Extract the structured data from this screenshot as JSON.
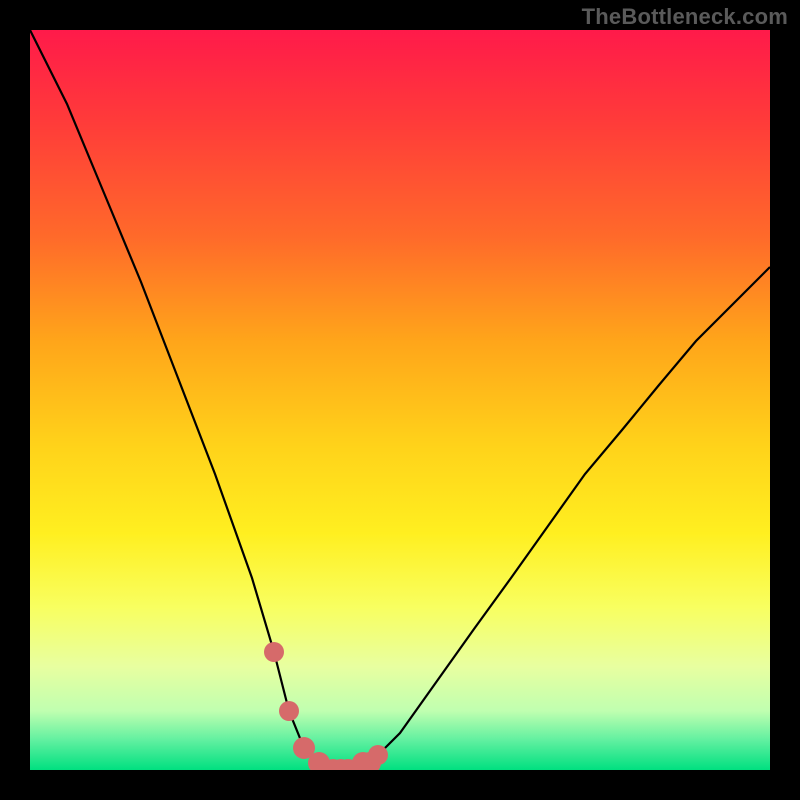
{
  "watermark": "TheBottleneck.com",
  "colors": {
    "frame": "#000000",
    "curve_stroke": "#000000",
    "marker_fill": "#d66a6a",
    "gradient_top": "#ff1a4a",
    "gradient_bottom": "#00e080"
  },
  "chart_data": {
    "type": "line",
    "title": "",
    "xlabel": "",
    "ylabel": "",
    "xlim": [
      0,
      100
    ],
    "ylim": [
      0,
      100
    ],
    "grid": false,
    "legend": "none",
    "series": [
      {
        "name": "bottleneck-curve",
        "x": [
          0,
          5,
          10,
          15,
          20,
          25,
          30,
          33,
          35,
          37,
          40,
          42,
          44,
          46,
          50,
          55,
          60,
          65,
          70,
          75,
          80,
          85,
          90,
          95,
          100
        ],
        "values": [
          100,
          90,
          78,
          66,
          53,
          40,
          26,
          16,
          8,
          3,
          0,
          0,
          0,
          1,
          5,
          12,
          19,
          26,
          33,
          40,
          46,
          52,
          58,
          63,
          68
        ]
      }
    ],
    "markers": {
      "name": "highlighted-points",
      "x": [
        33,
        35,
        37,
        39,
        40,
        41,
        42,
        43,
        44,
        45,
        46,
        47
      ],
      "values": [
        16,
        8,
        3,
        1,
        0,
        0,
        0,
        0,
        0,
        1,
        1,
        2
      ]
    }
  }
}
